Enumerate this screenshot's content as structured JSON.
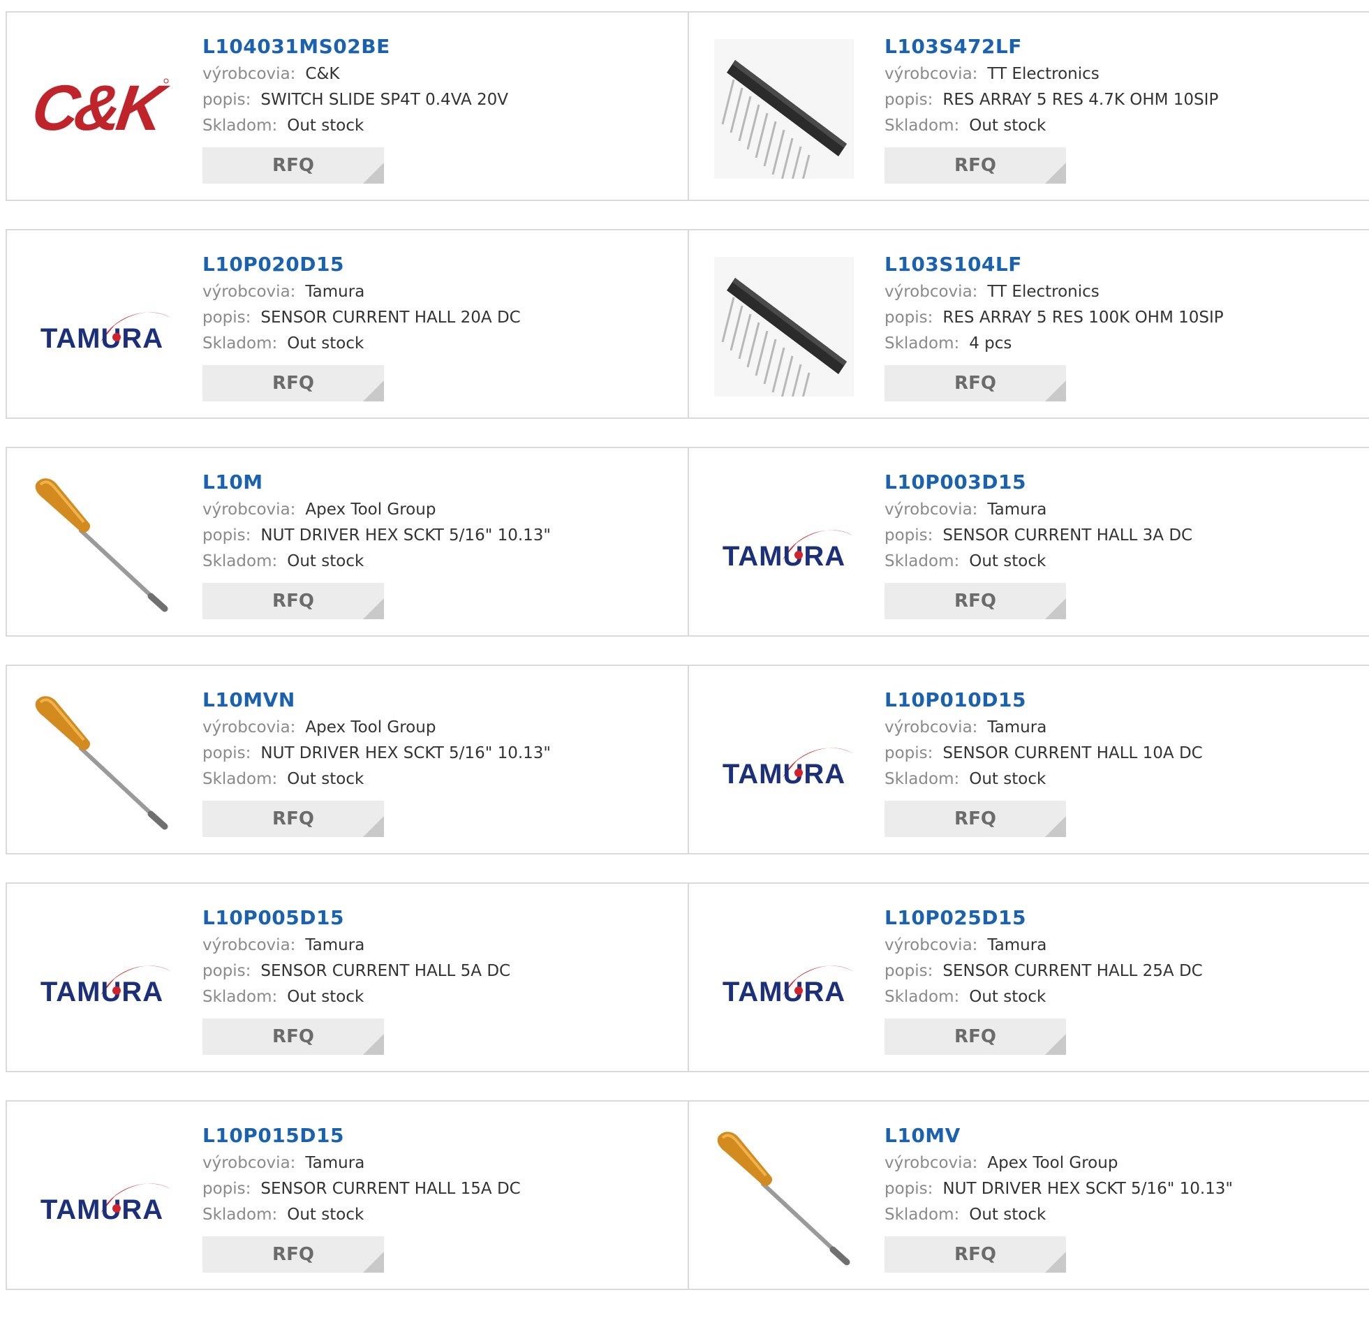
{
  "labels": {
    "manufacturer": "výrobcovia:",
    "description": "popis:",
    "stock": "Skladom:",
    "rfq": "RFQ"
  },
  "rows": [
    [
      {
        "part": "L104031MS02BE",
        "image": "ck-logo",
        "manufacturer": "C&K",
        "description": "SWITCH SLIDE SP4T 0.4VA 20V",
        "stock": "Out stock"
      },
      {
        "part": "L103S472LF",
        "image": "resistor-array",
        "manufacturer": "TT Electronics",
        "description": "RES ARRAY 5 RES 4.7K OHM 10SIP",
        "stock": "Out stock"
      }
    ],
    [
      {
        "part": "L10P020D15",
        "image": "tamura-logo",
        "manufacturer": "Tamura",
        "description": "SENSOR CURRENT HALL 20A DC",
        "stock": "Out stock"
      },
      {
        "part": "L103S104LF",
        "image": "resistor-array",
        "manufacturer": "TT Electronics",
        "description": "RES ARRAY 5 RES 100K OHM 10SIP",
        "stock": "4 pcs"
      }
    ],
    [
      {
        "part": "L10M",
        "image": "screwdriver",
        "manufacturer": "Apex Tool Group",
        "description": "NUT DRIVER HEX SCKT 5/16\" 10.13\"",
        "stock": "Out stock"
      },
      {
        "part": "L10P003D15",
        "image": "tamura-logo",
        "manufacturer": "Tamura",
        "description": "SENSOR CURRENT HALL 3A DC",
        "stock": "Out stock"
      }
    ],
    [
      {
        "part": "L10MVN",
        "image": "screwdriver",
        "manufacturer": "Apex Tool Group",
        "description": "NUT DRIVER HEX SCKT 5/16\" 10.13\"",
        "stock": "Out stock"
      },
      {
        "part": "L10P010D15",
        "image": "tamura-logo",
        "manufacturer": "Tamura",
        "description": "SENSOR CURRENT HALL 10A DC",
        "stock": "Out stock"
      }
    ],
    [
      {
        "part": "L10P005D15",
        "image": "tamura-logo",
        "manufacturer": "Tamura",
        "description": "SENSOR CURRENT HALL 5A DC",
        "stock": "Out stock"
      },
      {
        "part": "L10P025D15",
        "image": "tamura-logo",
        "manufacturer": "Tamura",
        "description": "SENSOR CURRENT HALL 25A DC",
        "stock": "Out stock"
      }
    ],
    [
      {
        "part": "L10P015D15",
        "image": "tamura-logo",
        "manufacturer": "Tamura",
        "description": "SENSOR CURRENT HALL 15A DC",
        "stock": "Out stock"
      },
      {
        "part": "L10MV",
        "image": "screwdriver",
        "manufacturer": "Apex Tool Group",
        "description": "NUT DRIVER HEX SCKT 5/16\" 10.13\"",
        "stock": "Out stock"
      }
    ]
  ],
  "colors": {
    "link": "#1a62b0",
    "label": "#8a8a8a",
    "button_bg": "#ececec",
    "button_text": "#6b6b6b",
    "border": "#dadada",
    "tamura_blue": "#1b2f7a",
    "tamura_red": "#d2232a",
    "ck_red": "#c0242b"
  },
  "logos": {
    "ck": "C&K",
    "tamura": "TAMURA"
  }
}
